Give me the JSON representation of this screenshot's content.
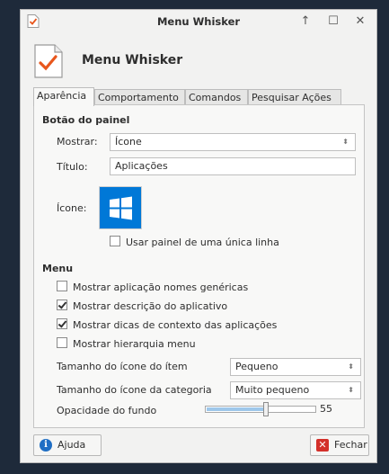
{
  "window": {
    "title": "Menu Whisker",
    "controls": [
      "↑",
      "☐",
      "✕"
    ],
    "header_title": "Menu Whisker"
  },
  "tabs": [
    {
      "label": "Aparência",
      "active": true
    },
    {
      "label": "Comportamento",
      "active": false
    },
    {
      "label": "Comandos",
      "active": false
    },
    {
      "label": "Pesquisar Ações",
      "active": false
    }
  ],
  "panel_button": {
    "section_title": "Botão do painel",
    "show_label": "Mostrar:",
    "show_value": "Ícone",
    "title_label": "Título:",
    "title_value": "Aplicações",
    "icon_label": "Ícone:",
    "single_row": {
      "label": "Usar painel de uma única linha",
      "checked": false
    }
  },
  "menu": {
    "section_title": "Menu",
    "generic_names": {
      "label": "Mostrar aplicação nomes genéricas",
      "checked": false
    },
    "description": {
      "label": "Mostrar descrição do aplicativo",
      "checked": true
    },
    "tooltips": {
      "label": "Mostrar dicas de contexto das aplicações",
      "checked": true
    },
    "hierarchy": {
      "label": "Mostrar hierarquia menu",
      "checked": false
    },
    "item_icon_size_label": "Tamanho do ícone do ítem",
    "item_icon_size_value": "Pequeno",
    "category_icon_size_label": "Tamanho do ícone da categoria",
    "category_icon_size_value": "Muito pequeno",
    "opacity_label": "Opacidade do fundo",
    "opacity_value": "55",
    "opacity_level": 0.55
  },
  "footer": {
    "help_label": "Ajuda",
    "close_label": "Fechar"
  },
  "icons": {
    "app": "menu-whisker-checklist-icon",
    "start": "windows-start-icon",
    "help": "info-icon",
    "close": "close-x-icon"
  },
  "colors": {
    "accent_blue": "#0078d7",
    "check_orange": "#e8561c",
    "slider_fill": "#9ec7ea",
    "close_red": "#d3302a"
  }
}
